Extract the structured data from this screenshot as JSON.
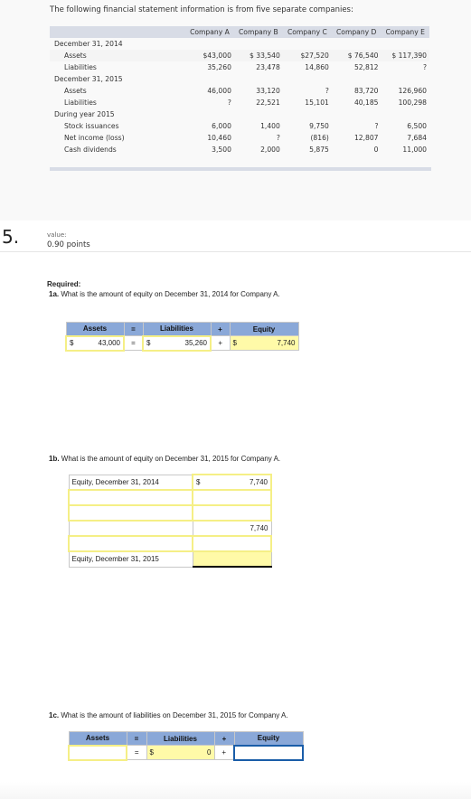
{
  "intro": "The following financial statement information is from five separate companies:",
  "fin_table": {
    "headers": [
      "Company A",
      "Company B",
      "Company C",
      "Company D",
      "Company E"
    ],
    "sections": [
      {
        "title": "December 31, 2014",
        "rows": [
          {
            "label": "Assets",
            "values": [
              "$43,000",
              "$ 33,540",
              "$27,520",
              "$ 76,540",
              "$ 117,390"
            ]
          },
          {
            "label": "Liabilities",
            "values": [
              "35,260",
              "23,478",
              "14,860",
              "52,812",
              "?"
            ]
          }
        ]
      },
      {
        "title": "December 31, 2015",
        "rows": [
          {
            "label": "Assets",
            "values": [
              "46,000",
              "33,120",
              "?",
              "83,720",
              "126,960"
            ]
          },
          {
            "label": "Liabilities",
            "values": [
              "?",
              "22,521",
              "15,101",
              "40,185",
              "100,298"
            ]
          }
        ]
      },
      {
        "title": "During year 2015",
        "rows": [
          {
            "label": "Stock issuances",
            "values": [
              "6,000",
              "1,400",
              "9,750",
              "?",
              "6,500"
            ]
          },
          {
            "label": "Net income (loss)",
            "values": [
              "10,460",
              "?",
              "(816)",
              "12,807",
              "7,684"
            ]
          },
          {
            "label": "Cash dividends",
            "values": [
              "3,500",
              "2,000",
              "5,875",
              "0",
              "11,000"
            ]
          }
        ]
      }
    ]
  },
  "question": {
    "number": "5.",
    "value_label": "value:",
    "points": "0.90 points"
  },
  "required_label": "Required:",
  "q1a": {
    "prefix": "1a.",
    "text": " What is the amount of equity on December 31, 2014 for Company A.",
    "headers": [
      "Assets",
      "=",
      "Liabilities",
      "+",
      "Equity"
    ],
    "assets_cur": "$",
    "assets": "43,000",
    "eq": "=",
    "liab_cur": "$",
    "liabilities": "35,260",
    "plus": "+",
    "equity_cur": "$",
    "equity": "7,740"
  },
  "q1b": {
    "prefix": "1b.",
    "text": " What is the amount of equity on December 31, 2015 for Company A.",
    "rows": [
      {
        "label": "Equity, December 31, 2014",
        "cur": "$",
        "amount": "7,740"
      },
      {
        "label": "",
        "cur": "",
        "amount": ""
      },
      {
        "label": "",
        "cur": "",
        "amount": ""
      },
      {
        "label": "",
        "cur": "",
        "amount": "7,740"
      },
      {
        "label": "",
        "cur": "",
        "amount": ""
      },
      {
        "label": "Equity, December 31, 2015",
        "cur": "",
        "amount": ""
      }
    ]
  },
  "q1c": {
    "prefix": "1c.",
    "text": " What is the amount of liabilities on December 31, 2015 for Company A.",
    "headers": [
      "Assets",
      "=",
      "Liabilities",
      "+",
      "Equity"
    ],
    "assets": "",
    "eq": "=",
    "liab_cur": "$",
    "liabilities": "0",
    "plus": "+",
    "equity": ""
  }
}
